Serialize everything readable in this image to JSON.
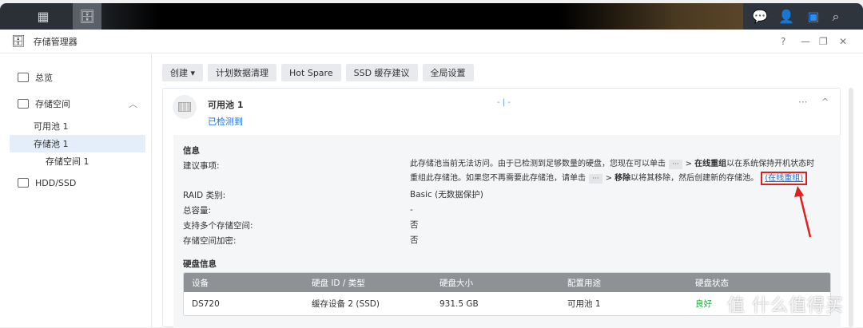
{
  "taskbar": {
    "icons": [
      "apps-grid-icon",
      "storage-manager-icon",
      "chat-icon",
      "user-icon",
      "widgets-icon",
      "search-icon"
    ]
  },
  "window": {
    "title": "存储管理器",
    "controls": [
      "?",
      "—",
      "❐",
      "✕"
    ]
  },
  "sidebar": {
    "items": [
      {
        "label": "总览"
      },
      {
        "label": "存储空间"
      },
      {
        "label": "可用池 1"
      },
      {
        "label": "存储池 1"
      },
      {
        "label": "存储空间 1"
      },
      {
        "label": "HDD/SSD"
      }
    ]
  },
  "toolbar": {
    "create": "创建 ▾",
    "schedule": "计划数据清理",
    "hotspare": "Hot Spare",
    "ssd": "SSD 缓存建议",
    "global": "全局设置"
  },
  "pool": {
    "name": "可用池 1",
    "status": "已检测到",
    "usage": "- | -",
    "more": "···",
    "collapse": "^"
  },
  "info": {
    "heading": "信息",
    "labels": [
      "建议事项:",
      "RAID 类别:",
      "总容量:",
      "支持多个存储空间:",
      "存储空间加密:"
    ],
    "advice_1": "此存储池当前无法访问。由于已检测到足够数量的硬盘，您现在可以单击",
    "dots": "···",
    "gt": ">",
    "online_rebuild": "在线重组",
    "advice_2": "以在系统保持开机状态时",
    "advice_3": "重组此存储池。如果您不再需要此存储池，请单击",
    "remove": "移除",
    "advice_4": "以将其移除，然后创建新的存储池。",
    "link": "(在线重组)",
    "raid": "Basic (无数据保护)",
    "capacity": "-",
    "multi": "否",
    "encrypt": "否"
  },
  "disk": {
    "heading": "硬盘信息",
    "columns": [
      "设备",
      "硬盘 ID / 类型",
      "硬盘大小",
      "配置用途",
      "硬盘状态"
    ],
    "rows": [
      {
        "device": "DS720",
        "id": "缓存设备 2 (SSD)",
        "size": "931.5 GB",
        "usage": "可用池 1",
        "status": "良好"
      }
    ]
  },
  "colors": {
    "status_good": "#28a745",
    "link": "#1a73e8",
    "highlight": "#e02020"
  },
  "watermark": "值 什么值得买"
}
